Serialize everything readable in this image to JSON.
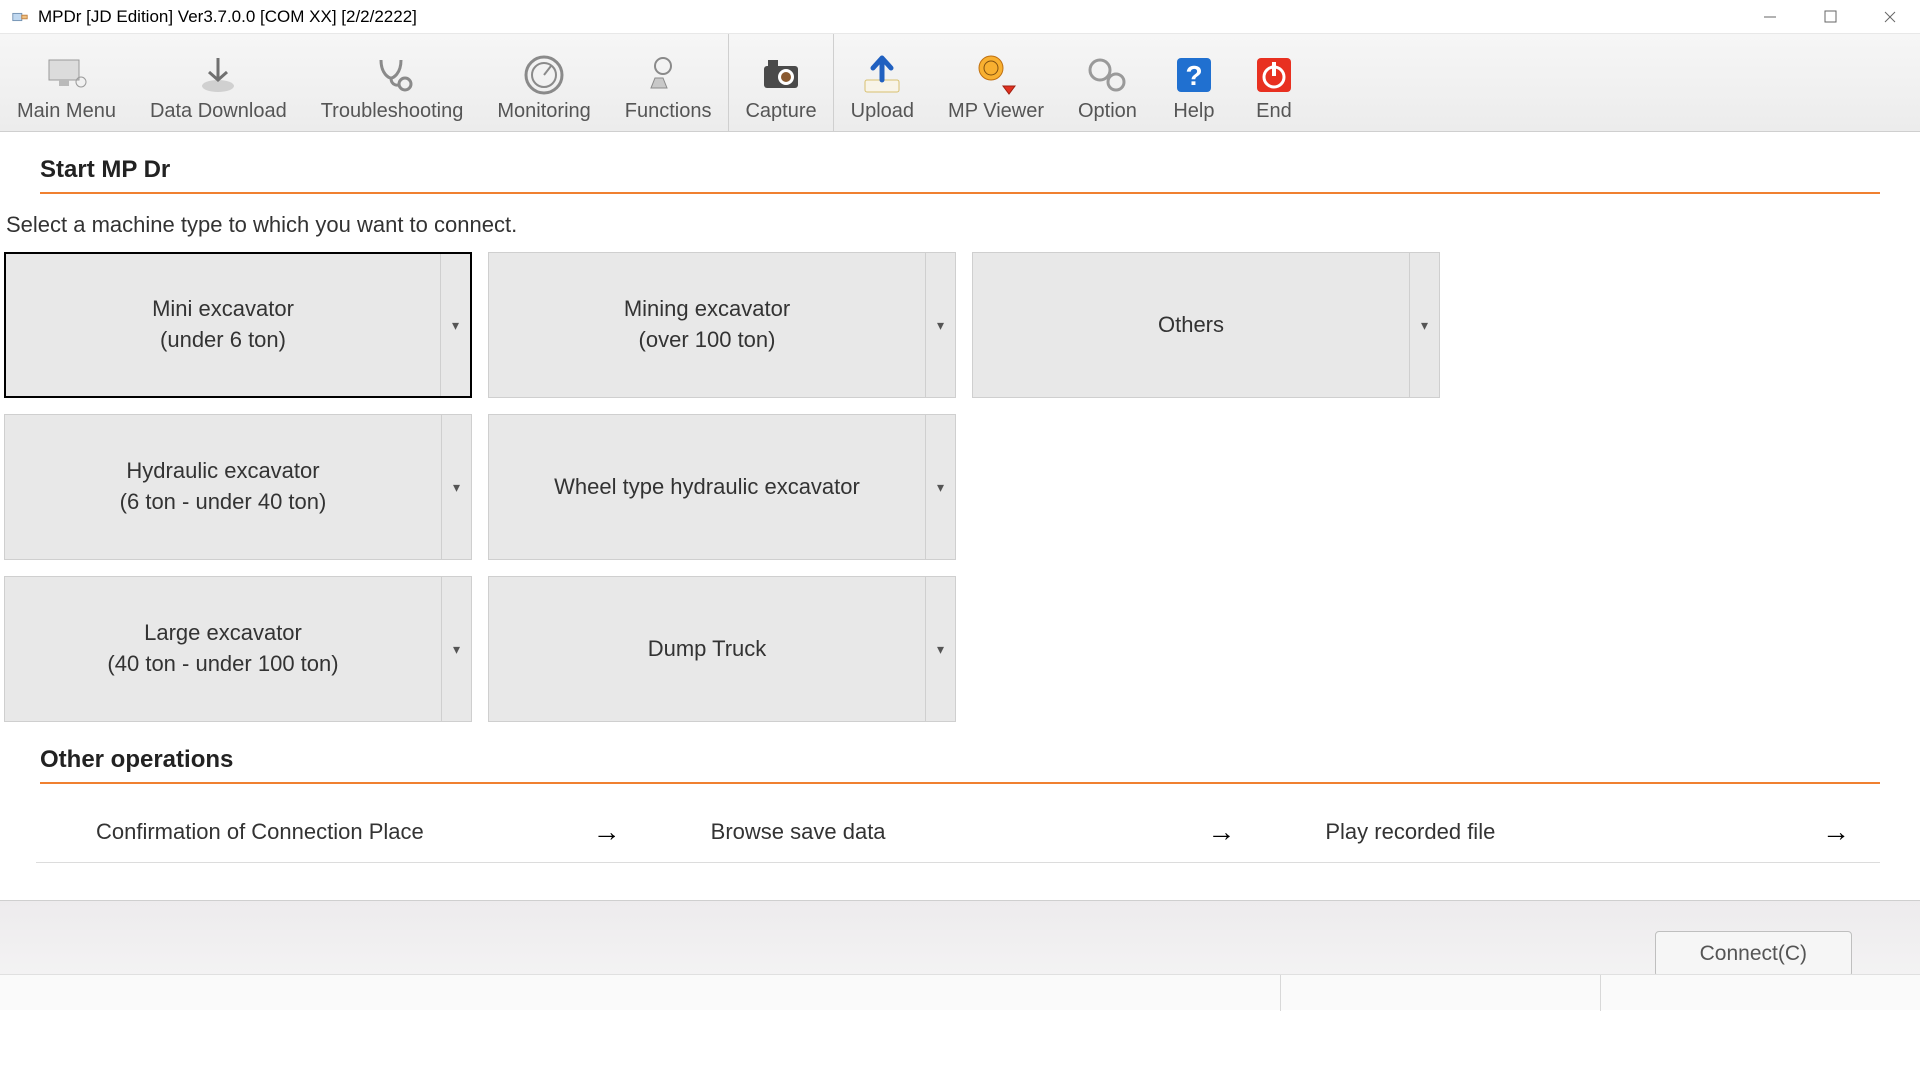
{
  "titlebar": {
    "title": "MPDr [JD Edition] Ver3.7.0.0 [COM XX] [2/2/2222]"
  },
  "toolbar": {
    "items": [
      {
        "id": "main_menu",
        "label": "Main Menu"
      },
      {
        "id": "data_download",
        "label": "Data Download"
      },
      {
        "id": "troubleshooting",
        "label": "Troubleshooting"
      },
      {
        "id": "monitoring",
        "label": "Monitoring"
      },
      {
        "id": "functions",
        "label": "Functions"
      },
      {
        "id": "capture",
        "label": "Capture"
      },
      {
        "id": "upload",
        "label": "Upload"
      },
      {
        "id": "mp_viewer",
        "label": "MP Viewer"
      },
      {
        "id": "option",
        "label": "Option"
      },
      {
        "id": "help",
        "label": "Help"
      },
      {
        "id": "end",
        "label": "End"
      }
    ]
  },
  "start": {
    "heading": "Start MP Dr",
    "instruction": "Select a machine type to which you want to connect.",
    "machines": [
      {
        "line1": "Mini excavator",
        "line2": "(under 6 ton)",
        "selected": true
      },
      {
        "line1": "Mining excavator",
        "line2": "(over 100 ton)"
      },
      {
        "line1": "Others",
        "line2": ""
      },
      {
        "line1": "Hydraulic excavator",
        "line2": "(6 ton - under 40 ton)"
      },
      {
        "line1": "Wheel type hydraulic excavator",
        "line2": ""
      },
      null,
      {
        "line1": "Large excavator",
        "line2": "(40 ton - under 100 ton)"
      },
      {
        "line1": "Dump Truck",
        "line2": ""
      },
      null
    ]
  },
  "ops": {
    "heading": "Other operations",
    "links": [
      {
        "label": "Confirmation of Connection Place"
      },
      {
        "label": "Browse save data"
      },
      {
        "label": "Play recorded file"
      }
    ]
  },
  "footer": {
    "connect_label": "Connect(C)"
  }
}
